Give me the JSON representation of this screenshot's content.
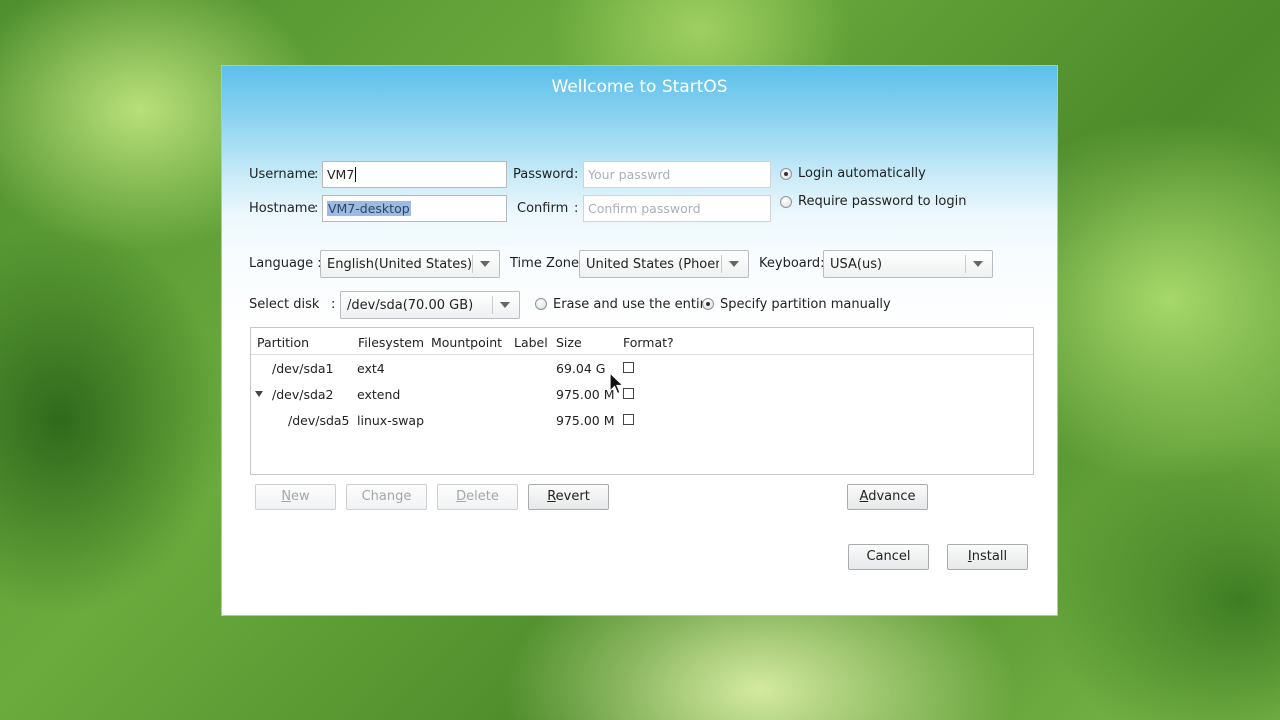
{
  "dialog": {
    "title": "Wellcome to StartOS"
  },
  "account": {
    "username_label": "Username",
    "username_value": "VM7",
    "hostname_label": "Hostname",
    "hostname_value": "VM7-desktop",
    "password_label": "Password",
    "password_placeholder": "Your passwrd",
    "confirm_label": "Confirm",
    "confirm_placeholder": "Confirm password",
    "login_auto_label": "Login automatically",
    "login_require_label": "Require password to login",
    "colon": ":"
  },
  "locale": {
    "language_label": "Language :",
    "language_value": "English(United States)",
    "timezone_label": "Time Zone:",
    "timezone_value": "United States (Phoeni:",
    "keyboard_label": "Keyboard:",
    "keyboard_value": "USA(us)"
  },
  "disk": {
    "select_label": "Select disk",
    "colon": ":",
    "disk_value": "/dev/sda(70.00 GB)",
    "erase_label": "Erase and use the entire",
    "manual_label": "Specify partition manually"
  },
  "partitions": {
    "headers": [
      "Partition",
      "Filesystem",
      "Mountpoint",
      "Label",
      "Size",
      "Format?"
    ],
    "rows": [
      {
        "partition": "/dev/sda1",
        "filesystem": "ext4",
        "mountpoint": "",
        "label": "",
        "size": "69.04 G",
        "format": false
      },
      {
        "partition": "/dev/sda2",
        "filesystem": "extend",
        "mountpoint": "",
        "label": "",
        "size": "975.00 M",
        "format": false
      },
      {
        "partition": "/dev/sda5",
        "filesystem": "linux-swap",
        "mountpoint": "",
        "label": "",
        "size": "975.00 M",
        "format": false
      }
    ]
  },
  "buttons": {
    "new_first": "N",
    "new_rest": "ew",
    "change": "Change",
    "delete_first": "D",
    "delete_rest": "elete",
    "revert_first": "R",
    "revert_rest": "evert",
    "advance_first": "A",
    "advance_rest": "dvance",
    "cancel": "Cancel",
    "install_first": "I",
    "install_rest": "nstall"
  }
}
